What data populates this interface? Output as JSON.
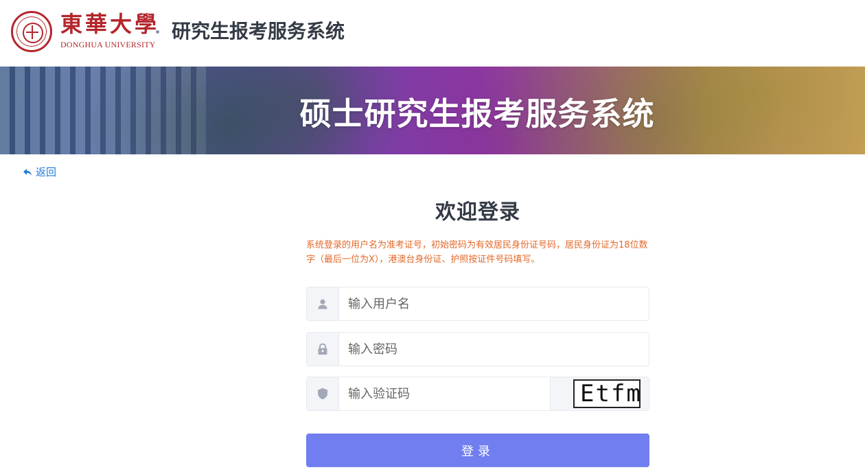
{
  "header": {
    "brand_cn": "東華大學",
    "brand_en": "DONGHUA UNIVERSITY",
    "system_title": "研究生报考服务系统"
  },
  "banner": {
    "title": "硕士研究生报考服务系统"
  },
  "nav": {
    "back_label": "返回"
  },
  "login": {
    "title": "欢迎登录",
    "notice": "系统登录的用户名为准考证号，初始密码为有效居民身份证号码，居民身份证为18位数字（最后一位为X），港澳台身份证、护照按证件号码填写。",
    "username_placeholder": "输入用户名",
    "password_placeholder": "输入密码",
    "captcha_placeholder": "输入验证码",
    "captcha_text": "Etfm",
    "submit_label": "登录"
  },
  "icons": {
    "username": "user-icon",
    "password": "lock-icon",
    "captcha": "shield-icon",
    "back": "reply-arrow-icon"
  },
  "colors": {
    "brand_red": "#b3262c",
    "link_blue": "#1f7ad6",
    "notice_orange": "#e3682a",
    "button": "#707ef0"
  }
}
